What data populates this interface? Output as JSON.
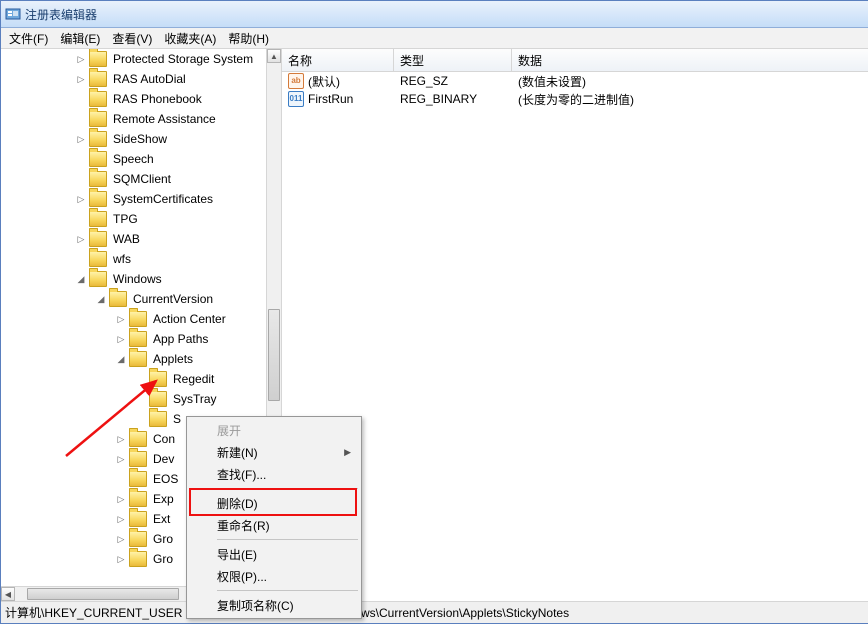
{
  "window": {
    "title": "注册表编辑器"
  },
  "menubar": [
    "文件(F)",
    "编辑(E)",
    "查看(V)",
    "收藏夹(A)",
    "帮助(H)"
  ],
  "tree": [
    {
      "depth": 0,
      "exp": "▷",
      "label": "Protected Storage System"
    },
    {
      "depth": 0,
      "exp": "▷",
      "label": "RAS AutoDial"
    },
    {
      "depth": 0,
      "exp": "",
      "label": "RAS Phonebook"
    },
    {
      "depth": 0,
      "exp": "",
      "label": "Remote Assistance"
    },
    {
      "depth": 0,
      "exp": "▷",
      "label": "SideShow"
    },
    {
      "depth": 0,
      "exp": "",
      "label": "Speech"
    },
    {
      "depth": 0,
      "exp": "",
      "label": "SQMClient"
    },
    {
      "depth": 0,
      "exp": "▷",
      "label": "SystemCertificates"
    },
    {
      "depth": 0,
      "exp": "",
      "label": "TPG"
    },
    {
      "depth": 0,
      "exp": "▷",
      "label": "WAB"
    },
    {
      "depth": 0,
      "exp": "",
      "label": "wfs"
    },
    {
      "depth": 0,
      "exp": "◢",
      "label": "Windows"
    },
    {
      "depth": 1,
      "exp": "◢",
      "label": "CurrentVersion"
    },
    {
      "depth": 2,
      "exp": "▷",
      "label": "Action Center"
    },
    {
      "depth": 2,
      "exp": "▷",
      "label": "App Paths"
    },
    {
      "depth": 2,
      "exp": "◢",
      "label": "Applets"
    },
    {
      "depth": 3,
      "exp": "",
      "label": "Regedit"
    },
    {
      "depth": 3,
      "exp": "",
      "label": "SysTray"
    },
    {
      "depth": 3,
      "exp": "",
      "label": "S"
    },
    {
      "depth": 2,
      "exp": "▷",
      "label": "Con"
    },
    {
      "depth": 2,
      "exp": "▷",
      "label": "Dev"
    },
    {
      "depth": 2,
      "exp": "",
      "label": "EOS"
    },
    {
      "depth": 2,
      "exp": "▷",
      "label": "Exp"
    },
    {
      "depth": 2,
      "exp": "▷",
      "label": "Ext"
    },
    {
      "depth": 2,
      "exp": "▷",
      "label": "Gro"
    },
    {
      "depth": 2,
      "exp": "▷",
      "label": "Gro"
    }
  ],
  "list": {
    "headers": [
      "名称",
      "类型",
      "数据"
    ],
    "rows": [
      {
        "icon": "str",
        "iconText": "ab",
        "name": "(默认)",
        "type": "REG_SZ",
        "data": "(数值未设置)"
      },
      {
        "icon": "bin",
        "iconText": "011",
        "name": "FirstRun",
        "type": "REG_BINARY",
        "data": "(长度为零的二进制值)"
      }
    ]
  },
  "context": [
    {
      "label": "展开",
      "disabled": true
    },
    {
      "label": "新建(N)",
      "sub": true
    },
    {
      "label": "查找(F)..."
    },
    {
      "sep": true
    },
    {
      "label": "删除(D)"
    },
    {
      "label": "重命名(R)"
    },
    {
      "sep": true
    },
    {
      "label": "导出(E)"
    },
    {
      "label": "权限(P)..."
    },
    {
      "sep": true
    },
    {
      "label": "复制项名称(C)"
    }
  ],
  "status": {
    "left": "计算机\\HKEY_CURRENT_USER",
    "right": "ws\\CurrentVersion\\Applets\\StickyNotes"
  }
}
